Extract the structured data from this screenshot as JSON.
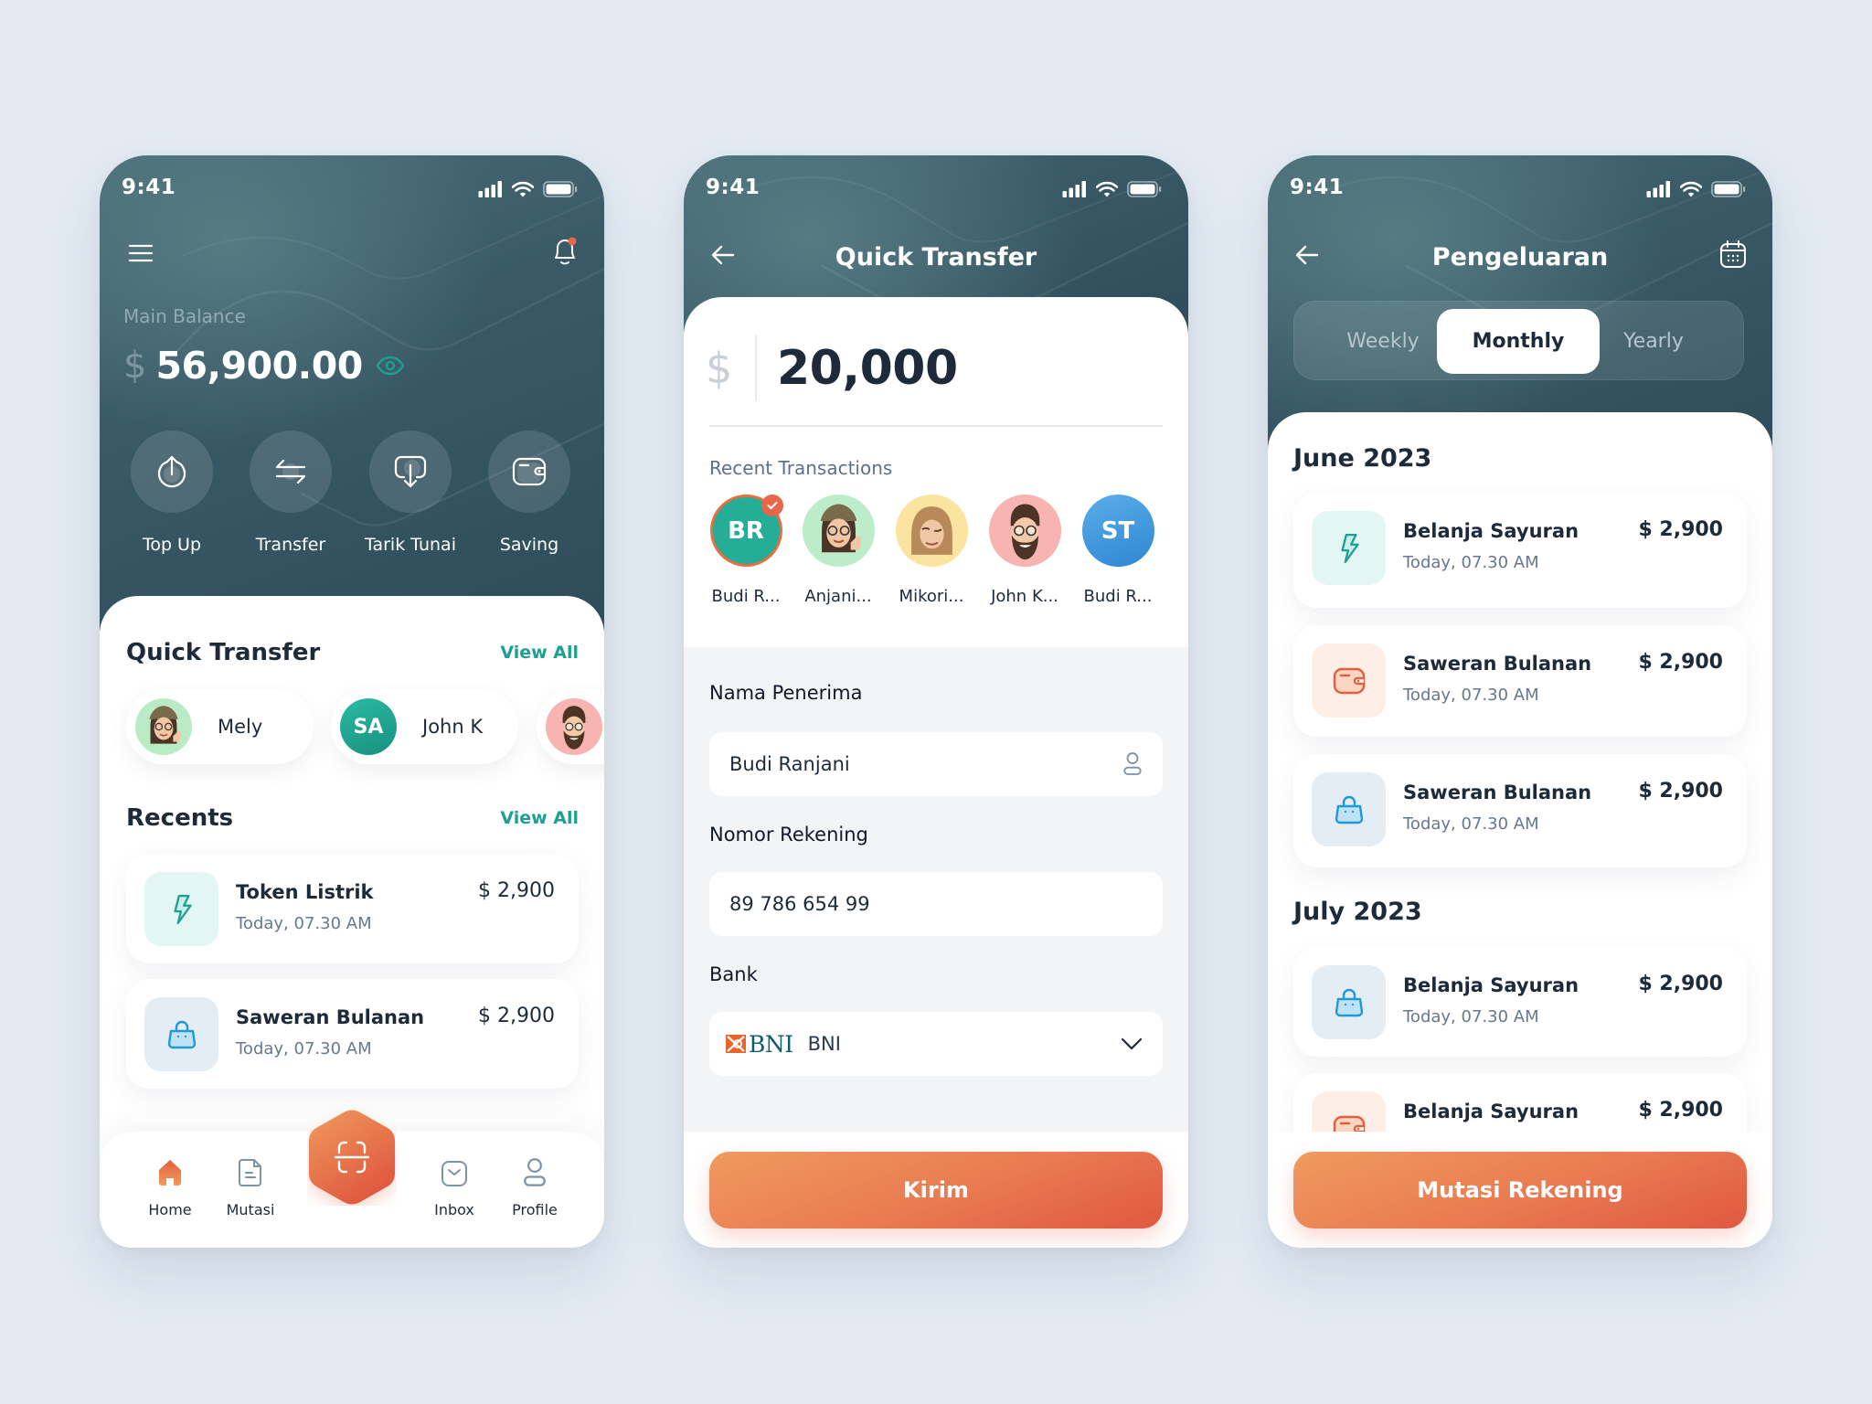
{
  "colors": {
    "header": "#33505d",
    "accent_teal": "#1ea091",
    "accent_orange": "#e97a51",
    "background": "#e3eaf2",
    "text_dark": "#1d2a3a",
    "badge_red": "#e8674a"
  },
  "status_bar": {
    "time": "9:41"
  },
  "home": {
    "menu_icon": "hamburger-icon",
    "notification_icon": "bell-icon",
    "balance_label": "Main Balance",
    "balance_currency": "$",
    "balance_amount": "56,900.00",
    "visibility_icon": "eye-icon",
    "actions": [
      {
        "label": "Top Up",
        "icon": "top-up-icon"
      },
      {
        "label": "Transfer",
        "icon": "transfer-icon"
      },
      {
        "label": "Tarik Tunai",
        "icon": "withdraw-icon"
      },
      {
        "label": "Saving",
        "icon": "wallet-icon"
      }
    ],
    "quick_transfer": {
      "title": "Quick Transfer",
      "view_all": "View All",
      "contacts": [
        {
          "name": "Mely",
          "initials": "",
          "avatar": "memoji-girl"
        },
        {
          "name": "John K",
          "initials": "SA",
          "avatar": "initials"
        },
        {
          "name": "",
          "initials": "",
          "avatar": "memoji-bearded-man"
        }
      ]
    },
    "recents": {
      "title": "Recents",
      "view_all": "View All",
      "items": [
        {
          "title": "Token Listrik",
          "date": "Today, 07.30 AM",
          "amount": "$ 2,900",
          "icon": "lightning-icon"
        },
        {
          "title": "Saweran Bulanan",
          "date": "Today, 07.30 AM",
          "amount": "$ 2,900",
          "icon": "shopping-bag-icon"
        }
      ]
    },
    "bottom_nav": [
      {
        "label": "Home",
        "icon": "home-icon",
        "active": true
      },
      {
        "label": "Mutasi",
        "icon": "document-icon",
        "active": false
      },
      {
        "label": "",
        "icon": "scan-icon",
        "active": false
      },
      {
        "label": "Inbox",
        "icon": "inbox-icon",
        "active": false
      },
      {
        "label": "Profile",
        "icon": "profile-icon",
        "active": false
      }
    ]
  },
  "quick_transfer_screen": {
    "title": "Quick Transfer",
    "currency": "$",
    "amount": "20,000",
    "recent_label": "Recent Transactions",
    "recent": [
      {
        "name": "Budi R...",
        "initials": "BR",
        "selected": true
      },
      {
        "name": "Anjani...",
        "initials": "",
        "selected": false
      },
      {
        "name": "Mikori...",
        "initials": "",
        "selected": false
      },
      {
        "name": "John K...",
        "initials": "",
        "selected": false
      },
      {
        "name": "Budi R...",
        "initials": "ST",
        "selected": false
      }
    ],
    "form": {
      "recipient_label": "Nama Penerima",
      "recipient_value": "Budi Ranjani",
      "account_label": "Nomor Rekening",
      "account_value": "89 786 654 99",
      "bank_label": "Bank",
      "bank_logo_text": "BNI",
      "bank_value": "BNI"
    },
    "submit_label": "Kirim"
  },
  "expenses_screen": {
    "title": "Pengeluaran",
    "tabs": [
      {
        "label": "Weekly",
        "active": false
      },
      {
        "label": "Monthly",
        "active": true
      },
      {
        "label": "Yearly",
        "active": false
      }
    ],
    "groups": [
      {
        "month": "June 2023",
        "items": [
          {
            "title": "Belanja Sayuran",
            "date": "Today, 07.30 AM",
            "amount": "$ 2,900",
            "icon": "lightning-icon"
          },
          {
            "title": "Saweran Bulanan",
            "date": "Today, 07.30 AM",
            "amount": "$ 2,900",
            "icon": "wallet-icon"
          },
          {
            "title": "Saweran Bulanan",
            "date": "Today, 07.30 AM",
            "amount": "$ 2,900",
            "icon": "shopping-bag-icon"
          }
        ]
      },
      {
        "month": "July 2023",
        "items": [
          {
            "title": "Belanja Sayuran",
            "date": "Today, 07.30 AM",
            "amount": "$ 2,900",
            "icon": "shopping-bag-icon"
          },
          {
            "title": "Belanja Sayuran",
            "date": "",
            "amount": "$ 2,900",
            "icon": "wallet-icon"
          }
        ]
      }
    ],
    "button_label": "Mutasi Rekening"
  }
}
